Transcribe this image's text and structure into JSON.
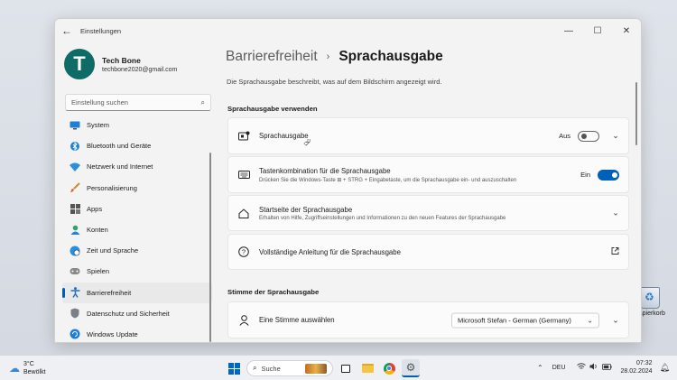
{
  "desktop": {
    "recycle_label": "Papierkorb"
  },
  "window": {
    "app_title": "Einstellungen",
    "back_glyph": "←",
    "controls": {
      "minimize": "—",
      "maximize": "☐",
      "close": "✕"
    }
  },
  "profile": {
    "initial": "T",
    "name": "Tech Bone",
    "email": "techbone2020@gmail.com",
    "avatar_color": "#0e6b66"
  },
  "search": {
    "placeholder": "Einstellung suchen"
  },
  "sidebar": {
    "items": [
      {
        "label": "System",
        "icon": "monitor-icon"
      },
      {
        "label": "Bluetooth und Geräte",
        "icon": "bluetooth-icon"
      },
      {
        "label": "Netzwerk und Internet",
        "icon": "wifi-icon"
      },
      {
        "label": "Personalisierung",
        "icon": "brush-icon"
      },
      {
        "label": "Apps",
        "icon": "apps-icon"
      },
      {
        "label": "Konten",
        "icon": "account-icon"
      },
      {
        "label": "Zeit und Sprache",
        "icon": "globe-clock-icon"
      },
      {
        "label": "Spielen",
        "icon": "gamepad-icon"
      },
      {
        "label": "Barrierefreiheit",
        "icon": "accessibility-icon",
        "active": true
      },
      {
        "label": "Datenschutz und Sicherheit",
        "icon": "shield-icon"
      },
      {
        "label": "Windows Update",
        "icon": "update-icon"
      }
    ]
  },
  "main": {
    "breadcrumb": {
      "parent": "Barrierefreiheit",
      "separator": "›",
      "current": "Sprachausgabe"
    },
    "description": "Die Sprachausgabe beschreibt, was auf dem Bildschirm angezeigt wird.",
    "section1": "Sprachausgabe verwenden",
    "section2": "Stimme der Sprachausgabe",
    "cards": {
      "narrator": {
        "title": "Sprachausgabe",
        "toggle_label": "Aus",
        "toggle_on": false
      },
      "shortcut": {
        "title": "Tastenkombination für die Sprachausgabe",
        "subtitle": "Drücken Sie die Windows-Taste ⊞ + STRG + Eingabetaste, um die Sprachausgabe ein- und auszuschalten",
        "toggle_label": "Ein",
        "toggle_on": true
      },
      "home": {
        "title": "Startseite der Sprachausgabe",
        "subtitle": "Erhalten von Hilfe, Zugriffseinstellungen und Informationen zu den neuen Features der Sprachausgabe"
      },
      "guide": {
        "title": "Vollständige Anleitung für die Sprachausgabe"
      },
      "voice": {
        "title": "Eine Stimme auswählen",
        "selected": "Microsoft Stefan - German (Germany)"
      }
    },
    "accent_color": "#005fb8"
  },
  "taskbar": {
    "weather": {
      "temp": "3°C",
      "condition": "Bewölkt"
    },
    "search_label": "Suche",
    "tray": {
      "language": "DEU"
    },
    "clock": {
      "time": "07:32",
      "date": "28.02.2024"
    }
  }
}
